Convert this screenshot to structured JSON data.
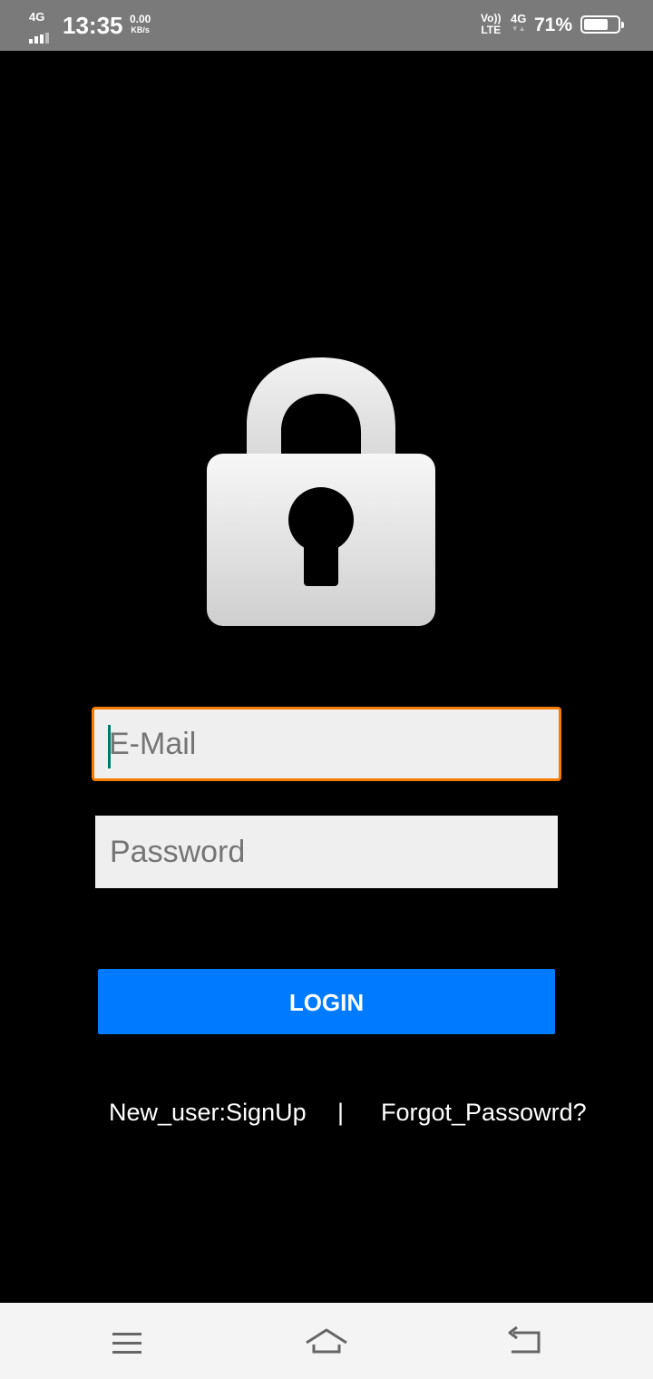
{
  "status_bar": {
    "network": "4G",
    "time": "13:35",
    "speed_value": "0.00",
    "speed_unit": "KB/s",
    "volte_top": "Vo))",
    "volte_bottom": "LTE",
    "network_right": "4G",
    "battery_percent": "71%",
    "battery_level": 0.71
  },
  "login": {
    "email_placeholder": "E-Mail",
    "password_placeholder": "Password",
    "login_label": "LOGIN"
  },
  "links": {
    "signup": "New_user:SignUp",
    "separator": "|",
    "forgot": "Forgot_Passowrd?"
  },
  "colors": {
    "accent_focus": "#f57c00",
    "button": "#007bff",
    "cursor": "#00796b",
    "status_bar": "#7a7a7a"
  },
  "icons": {
    "lock": "lock-icon",
    "menu": "menu-icon",
    "home": "home-icon",
    "back": "back-icon"
  }
}
